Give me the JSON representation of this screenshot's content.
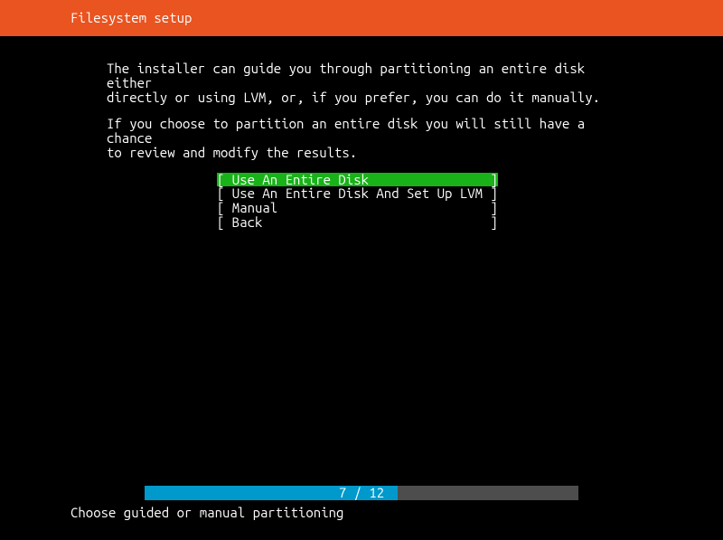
{
  "header": {
    "title": "Filesystem setup"
  },
  "body": {
    "p1": "The installer can guide you through partitioning an entire disk either\ndirectly or using LVM, or, if you prefer, you can do it manually.",
    "p2": "If you choose to partition an entire disk you will still have a chance\nto review and modify the results."
  },
  "menu": {
    "items": [
      {
        "label": "Use An Entire Disk",
        "selected": true
      },
      {
        "label": "Use An Entire Disk And Set Up LVM",
        "selected": false
      },
      {
        "label": "Manual",
        "selected": false
      },
      {
        "label": "Back",
        "selected": false
      }
    ]
  },
  "progress": {
    "current": 7,
    "total": 12,
    "label": "7 / 12"
  },
  "hint": "Choose guided or manual partitioning",
  "colors": {
    "accent": "#e95420",
    "selected": "#19b219",
    "progress_fill": "#0099cc",
    "progress_bg": "#4d4d4d"
  }
}
